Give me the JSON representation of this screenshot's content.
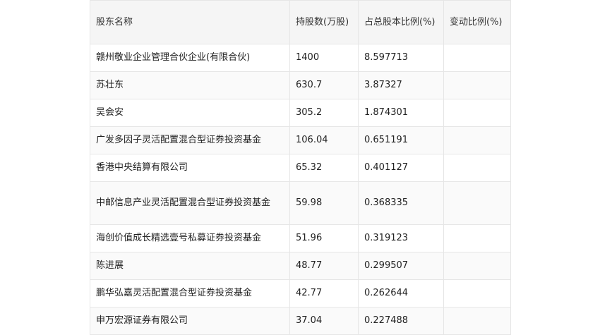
{
  "table": {
    "headers": [
      "股东名称",
      "持股数(万股)",
      "占总股本比例(%)",
      "变动比例(%)"
    ],
    "rows": [
      [
        "赣州敬业企业管理合伙企业(有限合伙)",
        "1400",
        "8.597713",
        ""
      ],
      [
        "苏壮东",
        "630.7",
        "3.87327",
        ""
      ],
      [
        "吴会安",
        "305.2",
        "1.874301",
        ""
      ],
      [
        "广发多因子灵活配置混合型证券投资基金",
        "106.04",
        "0.651191",
        ""
      ],
      [
        "香港中央结算有限公司",
        "65.32",
        "0.401127",
        ""
      ],
      [
        "中邮信息产业灵活配置混合型证券投资基金",
        "59.98",
        "0.368335",
        ""
      ],
      [
        "海创价值成长精选壹号私募证券投资基金",
        "51.96",
        "0.319123",
        ""
      ],
      [
        "陈进展",
        "48.77",
        "0.299507",
        ""
      ],
      [
        "鹏华弘嘉灵活配置混合型证券投资基金",
        "42.77",
        "0.262644",
        ""
      ],
      [
        "申万宏源证券有限公司",
        "37.04",
        "0.227488",
        ""
      ]
    ]
  }
}
